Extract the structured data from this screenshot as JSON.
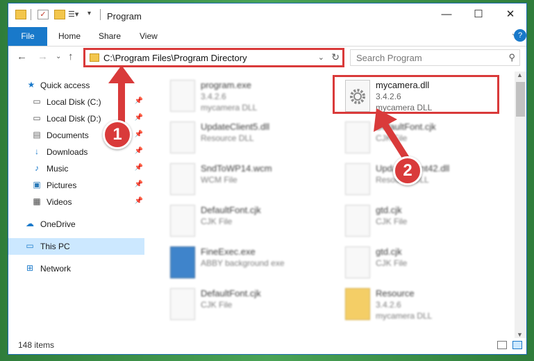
{
  "window": {
    "title": "Program"
  },
  "ribbon": {
    "tabs": [
      "File",
      "Home",
      "Share",
      "View"
    ]
  },
  "address": {
    "path": "C:\\Program Files\\Program Directory"
  },
  "search": {
    "placeholder": "Search Program"
  },
  "sidebar": {
    "items": [
      {
        "label": "Quick access",
        "icon": "star-icon",
        "pinned": false
      },
      {
        "label": "Local Disk (C:)",
        "icon": "drive-icon",
        "pinned": true
      },
      {
        "label": "Local Disk (D:)",
        "icon": "drive-icon",
        "pinned": true
      },
      {
        "label": "Documents",
        "icon": "documents-icon",
        "pinned": true
      },
      {
        "label": "Downloads",
        "icon": "download-icon",
        "pinned": true
      },
      {
        "label": "Music",
        "icon": "music-icon",
        "pinned": true
      },
      {
        "label": "Pictures",
        "icon": "pictures-icon",
        "pinned": true
      },
      {
        "label": "Videos",
        "icon": "videos-icon",
        "pinned": true
      },
      {
        "label": "OneDrive",
        "icon": "cloud-icon",
        "pinned": false
      },
      {
        "label": "This PC",
        "icon": "computer-icon",
        "pinned": false,
        "selected": true
      },
      {
        "label": "Network",
        "icon": "network-icon",
        "pinned": false
      }
    ]
  },
  "files": [
    {
      "name": "program.exe",
      "sub": "3.4.2.6",
      "sub2": "mycamera DLL",
      "icon": "exe-icon",
      "highlighted": false
    },
    {
      "name": "mycamera.dll",
      "sub": "3.4.2.6",
      "sub2": "mycamera DLL",
      "icon": "dll-icon",
      "highlighted": true
    },
    {
      "name": "UpdateClient5.dll",
      "sub": "Resource DLL",
      "sub2": "",
      "icon": "dll-icon",
      "highlighted": false
    },
    {
      "name": "DefaultFont.cjk",
      "sub": "CJK File",
      "sub2": "",
      "icon": "file-icon",
      "highlighted": false
    },
    {
      "name": "SndToWP14.wcm",
      "sub": "WCM File",
      "sub2": "",
      "icon": "file-icon",
      "highlighted": false
    },
    {
      "name": "UpdateClient42.dll",
      "sub": "Resource DLL",
      "sub2": "",
      "icon": "dll-icon",
      "highlighted": false
    },
    {
      "name": "DefaultFont.cjk",
      "sub": "CJK File",
      "sub2": "",
      "icon": "file-icon",
      "highlighted": false
    },
    {
      "name": "gtd.cjk",
      "sub": "CJK File",
      "sub2": "",
      "icon": "file-icon",
      "highlighted": false
    },
    {
      "name": "FineExec.exe",
      "sub": "ABBY background exe",
      "sub2": "",
      "icon": "exe-icon",
      "highlighted": false
    },
    {
      "name": "gtd.cjk",
      "sub": "CJK File",
      "sub2": "",
      "icon": "file-icon",
      "highlighted": false
    },
    {
      "name": "DefaultFont.cjk",
      "sub": "CJK File",
      "sub2": "",
      "icon": "file-icon",
      "highlighted": false
    },
    {
      "name": "Resource",
      "sub": "3.4.2.6",
      "sub2": "mycamera DLL",
      "icon": "folder-icon",
      "highlighted": false
    }
  ],
  "status": {
    "item_count": "148 items"
  },
  "annotations": {
    "callout1": "1",
    "callout2": "2",
    "color": "#d93a3a"
  }
}
